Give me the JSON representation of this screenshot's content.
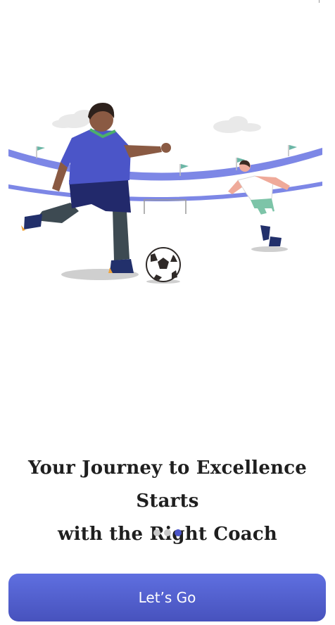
{
  "onboarding": {
    "headline_line1": "Your Journey to Excellence Starts",
    "headline_line2": "with the Right Coach",
    "page_count": 3,
    "active_page": 3,
    "cta_label": "Let’s Go"
  },
  "colors": {
    "accent": "#4b55c8",
    "dot_inactive": "#c9c9c9",
    "button_top": "#5f6fe0",
    "button_bottom": "#4752bd"
  },
  "illustration": {
    "subject": "soccer-players-illustration"
  }
}
